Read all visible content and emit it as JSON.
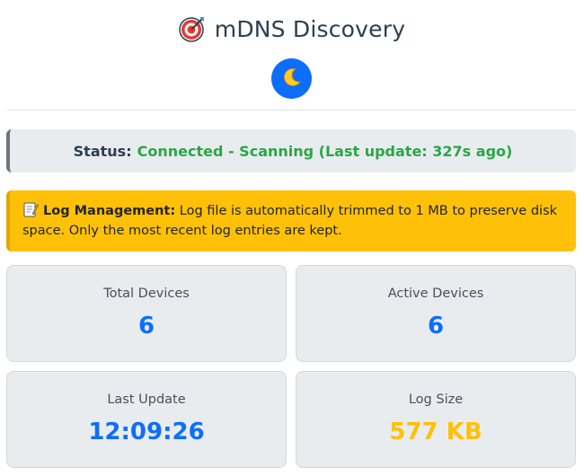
{
  "header": {
    "title": "mDNS Discovery",
    "title_icon": "target-icon",
    "theme_toggle_icon": "moon-icon"
  },
  "status": {
    "label": "Status:",
    "value": "Connected - Scanning (Last update: 327s ago)",
    "value_color": "#28a745"
  },
  "log_notice": {
    "icon": "memo-icon",
    "title": "Log Management:",
    "text": "Log file is automatically trimmed to 1 MB to preserve disk space. Only the most recent log entries are kept."
  },
  "stats": [
    {
      "label": "Total Devices",
      "value": "6",
      "color": "#0d6efd"
    },
    {
      "label": "Active Devices",
      "value": "6",
      "color": "#0d6efd"
    },
    {
      "label": "Last Update",
      "value": "12:09:26",
      "color": "#0d6efd"
    },
    {
      "label": "Log Size",
      "value": "577 KB",
      "color": "#ffc107"
    }
  ],
  "colors": {
    "accent": "#0d6efd",
    "warning": "#ffc107",
    "success": "#28a745",
    "card_bg": "#e9ecef"
  }
}
